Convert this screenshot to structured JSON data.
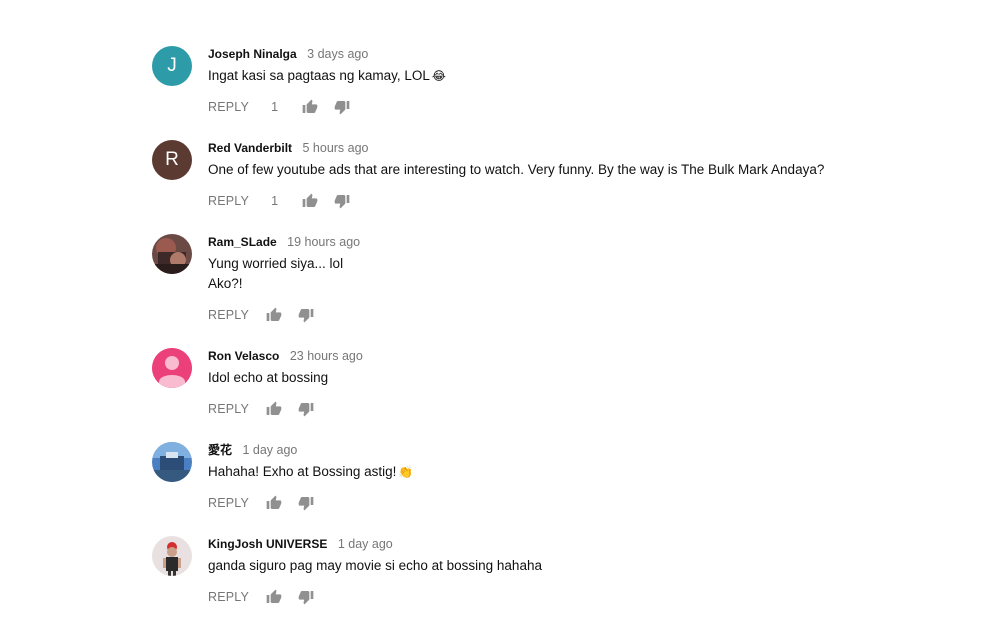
{
  "comments": [
    {
      "author": "Joseph Ninalga",
      "time": "3 days ago",
      "lines": [
        "Ingat kasi sa pagtaas ng kamay, LOL"
      ],
      "emoji": "😂",
      "avatar": {
        "type": "letter",
        "letter": "J",
        "color": "#2d9ba8"
      },
      "reply_label": "REPLY",
      "likes": "1"
    },
    {
      "author": "Red Vanderbilt",
      "time": "5 hours ago",
      "lines": [
        "One of few youtube ads that are interesting to watch. Very funny. By the way is The Bulk Mark Andaya?"
      ],
      "avatar": {
        "type": "letter",
        "letter": "R",
        "color": "#5b3a31"
      },
      "reply_label": "REPLY",
      "likes": "1"
    },
    {
      "author": "Ram_SLade",
      "time": "19 hours ago",
      "lines": [
        "Yung worried siya... lol",
        "Ako?!"
      ],
      "avatar": {
        "type": "photo",
        "icon": "photo-avatar-dark-red"
      },
      "reply_label": "REPLY",
      "likes": ""
    },
    {
      "author": "Ron Velasco",
      "time": "23 hours ago",
      "lines": [
        "Idol echo at bossing"
      ],
      "avatar": {
        "type": "default",
        "icon": "person-icon",
        "color": "#ec407a"
      },
      "reply_label": "REPLY",
      "likes": ""
    },
    {
      "author": "愛花",
      "time": "1 day ago",
      "lines": [
        "Hahaha! Exho at Bossing astig!"
      ],
      "emoji": "👏",
      "avatar": {
        "type": "photo",
        "icon": "photo-avatar-blue"
      },
      "reply_label": "REPLY",
      "likes": ""
    },
    {
      "author": "KingJosh UNIVERSE",
      "time": "1 day ago",
      "lines": [
        "ganda siguro pag may movie si echo at bossing hahaha"
      ],
      "avatar": {
        "type": "photo",
        "icon": "photo-avatar-person"
      },
      "reply_label": "REPLY",
      "likes": ""
    }
  ],
  "colors": {
    "meta_gray": "#767676",
    "icon_gray": "#909090",
    "text": "#111111"
  }
}
